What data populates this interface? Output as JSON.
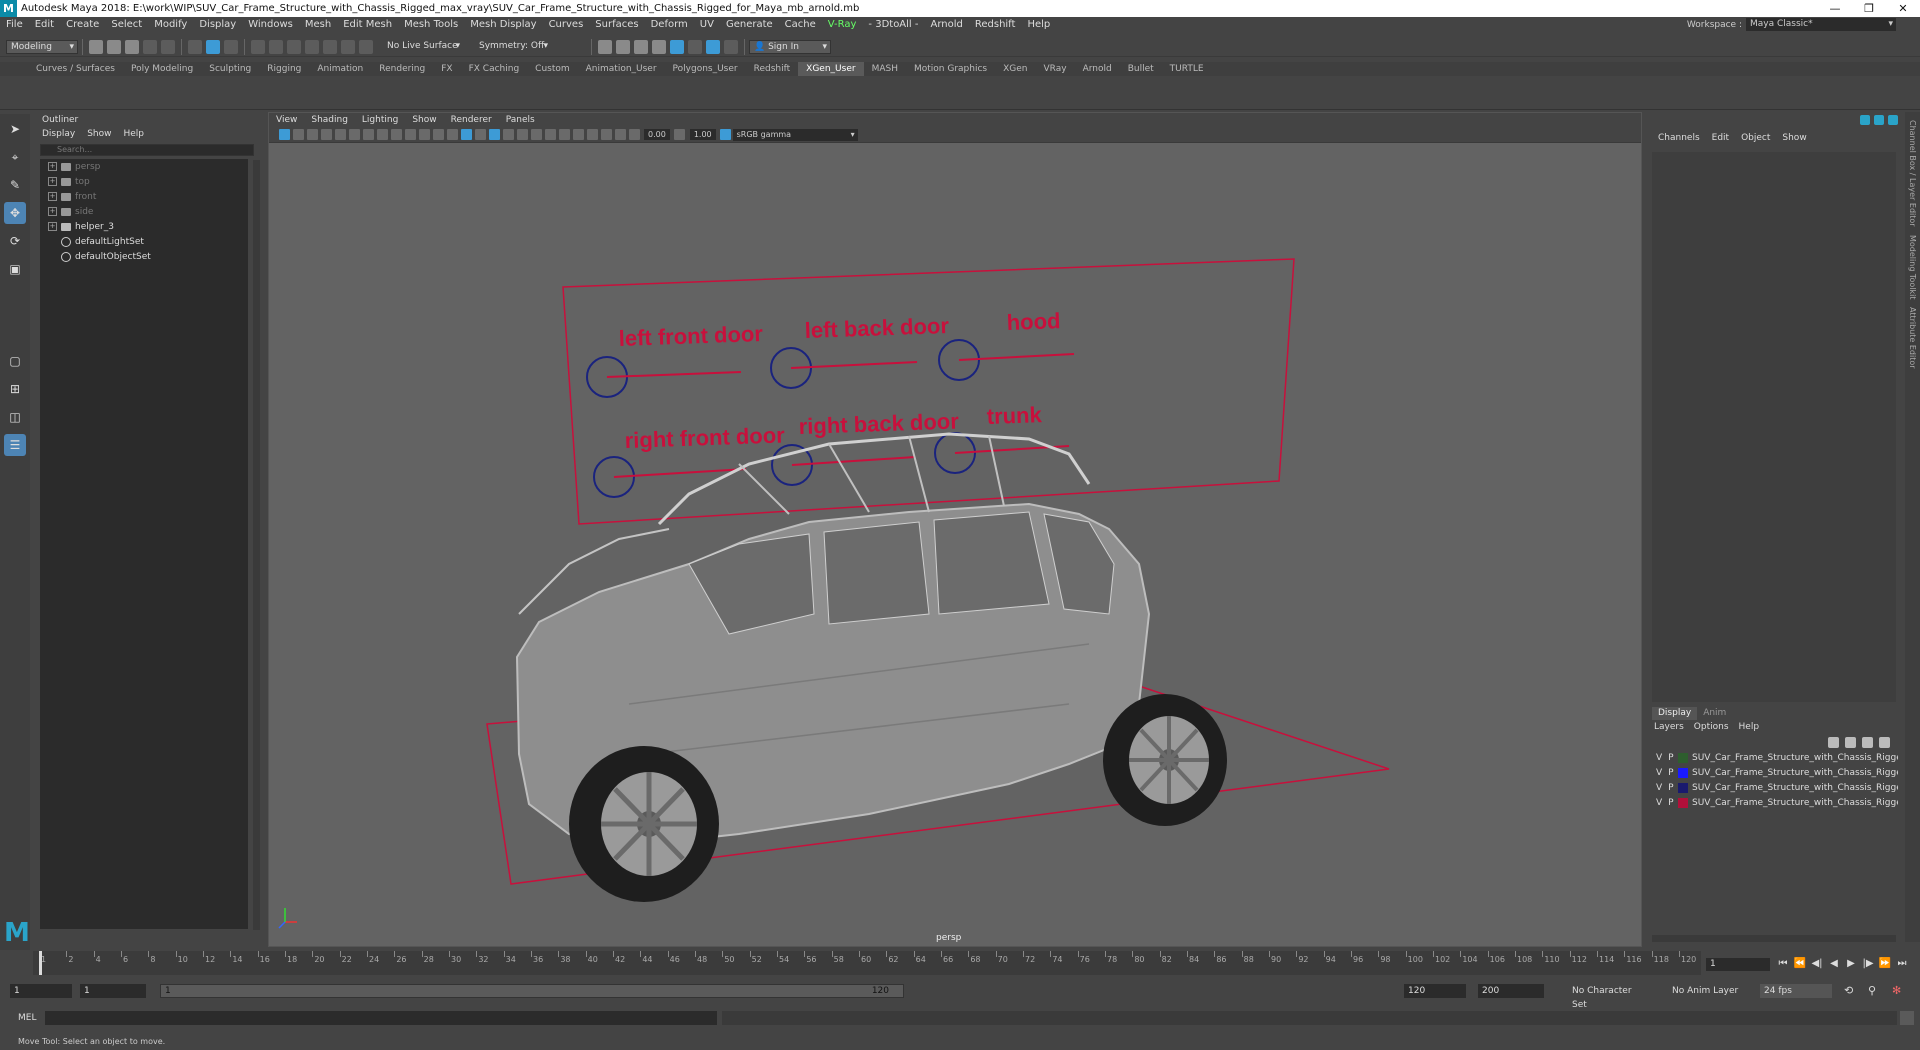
{
  "titlebar": {
    "logo": "M",
    "title": "Autodesk Maya 2018: E:\\work\\WIP\\SUV_Car_Frame_Structure_with_Chassis_Rigged_max_vray\\SUV_Car_Frame_Structure_with_Chassis_Rigged_for_Maya_mb_arnold.mb",
    "minimize": "—",
    "restore": "❐",
    "close": "✕"
  },
  "menu": [
    "File",
    "Edit",
    "Create",
    "Select",
    "Modify",
    "Display",
    "Windows",
    "Mesh",
    "Edit Mesh",
    "Mesh Tools",
    "Mesh Display",
    "Curves",
    "Surfaces",
    "Deform",
    "UV",
    "Generate",
    "Cache",
    "V-Ray",
    "- 3DtoAll -",
    "Arnold",
    "Redshift",
    "Help"
  ],
  "workspace": {
    "label": "Workspace :",
    "value": "Maya Classic*"
  },
  "statusline": {
    "mode": "Modeling",
    "live_surface": "No Live Surface",
    "symmetry": "Symmetry: Off",
    "sign_in": "Sign In"
  },
  "shelf_tabs": [
    "Curves / Surfaces",
    "Poly Modeling",
    "Sculpting",
    "Rigging",
    "Animation",
    "Rendering",
    "FX",
    "FX Caching",
    "Custom",
    "Animation_User",
    "Polygons_User",
    "Redshift",
    "XGen_User",
    "MASH",
    "Motion Graphics",
    "XGen",
    "VRay",
    "Arnold",
    "Bullet",
    "TURTLE"
  ],
  "active_shelf": "XGen_User",
  "outliner": {
    "title": "Outliner",
    "menu": [
      "Display",
      "Show",
      "Help"
    ],
    "search_placeholder": "Search...",
    "items": [
      {
        "name": "persp",
        "dim": true,
        "type": "camera"
      },
      {
        "name": "top",
        "dim": true,
        "type": "camera"
      },
      {
        "name": "front",
        "dim": true,
        "type": "camera"
      },
      {
        "name": "side",
        "dim": true,
        "type": "camera"
      },
      {
        "name": "helper_3",
        "dim": false,
        "type": "transform"
      },
      {
        "name": "defaultLightSet",
        "dim": false,
        "type": "set"
      },
      {
        "name": "defaultObjectSet",
        "dim": false,
        "type": "set"
      }
    ]
  },
  "viewport": {
    "menu": [
      "View",
      "Shading",
      "Lighting",
      "Show",
      "Renderer",
      "Panels"
    ],
    "exposure": "0.00",
    "gamma": "1.00",
    "color_space": "sRGB gamma",
    "camera": "persp",
    "control_labels": [
      "left front door",
      "left back door",
      "hood",
      "right front door",
      "right back door",
      "trunk"
    ],
    "accent_red": "#c8103c",
    "accent_blue": "#1a237e"
  },
  "channelbox": {
    "menu": [
      "Channels",
      "Edit",
      "Object",
      "Show"
    ]
  },
  "side_tabs": [
    "Channel Box / Layer Editor",
    "Modeling Toolkit",
    "Attribute Editor"
  ],
  "layers": {
    "tabs": [
      "Display",
      "Anim"
    ],
    "menu": [
      "Layers",
      "Options",
      "Help"
    ],
    "items": [
      {
        "v": "V",
        "p": "P",
        "color": "#2e5e2e",
        "name": "SUV_Car_Frame_Structure_with_Chassis_Rigged_chassis"
      },
      {
        "v": "V",
        "p": "P",
        "color": "#1a1aff",
        "name": "SUV_Car_Frame_Structure_with_Chassis_Rigged_Frame"
      },
      {
        "v": "V",
        "p": "P",
        "color": "#1a1a6e",
        "name": "SUV_Car_Frame_Structure_with_Chassis_Rigged_controllers"
      },
      {
        "v": "V",
        "p": "P",
        "color": "#b0103a",
        "name": "SUV_Car_Frame_Structure_with_Chassis_Rigged_helpers"
      }
    ]
  },
  "timeline": {
    "ticks": [
      "1",
      "2",
      "4",
      "6",
      "8",
      "10",
      "12",
      "14",
      "16",
      "18",
      "20",
      "22",
      "24",
      "26",
      "28",
      "30",
      "32",
      "34",
      "36",
      "38",
      "40",
      "42",
      "44",
      "46",
      "48",
      "50",
      "52",
      "54",
      "56",
      "58",
      "60",
      "62",
      "64",
      "66",
      "68",
      "70",
      "72",
      "74",
      "76",
      "78",
      "80",
      "82",
      "84",
      "86",
      "88",
      "90",
      "92",
      "94",
      "96",
      "98",
      "100",
      "102",
      "104",
      "106",
      "108",
      "110",
      "112",
      "114",
      "116",
      "118",
      "120"
    ],
    "current_frame": "1"
  },
  "range": {
    "start": "1",
    "anim_start": "1",
    "range_start": "1",
    "range_end": "120",
    "end": "120",
    "anim_end": "200",
    "character_set": "No Character Set",
    "anim_layer": "No Anim Layer",
    "fps": "24 fps"
  },
  "cmd": {
    "label": "MEL"
  },
  "help": "Move Tool: Select an object to move."
}
